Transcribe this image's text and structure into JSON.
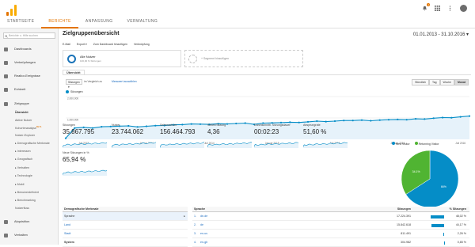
{
  "header": {
    "tabs": [
      "STARTSEITE",
      "BERICHTE",
      "ANPASSUNG",
      "VERWALTUNG"
    ],
    "active_tab": 1,
    "notification_count": "1",
    "colors": {
      "accent": "#e37400",
      "logo_a": "#f9ab00",
      "logo_b": "#e37400"
    }
  },
  "sidebar": {
    "search_placeholder": "Berichte u. Hilfe suchen",
    "items": [
      {
        "label": "Dashboards",
        "icon": "dashboard-icon"
      },
      {
        "label": "Verknüpfungen",
        "icon": "shortcut-icon"
      },
      {
        "label": "Realtor-Ereignisse",
        "icon": "bell-icon"
      },
      {
        "label": "Echtzeit",
        "icon": "clock-icon"
      },
      {
        "label": "Zielgruppe",
        "icon": "person-icon"
      },
      {
        "label": "Akquisition",
        "icon": "acquisition-icon"
      },
      {
        "label": "Verhalten",
        "icon": "behavior-icon"
      }
    ],
    "subitems": [
      "Übersicht",
      "Aktive Nutzer",
      "Kohortenanalyse",
      "Nutzer-Explorer",
      "▸ Demografische Merkmale",
      "▸ Interessen",
      "▸ Geografisch",
      "▸ Verhalten",
      "▸ Technologie",
      "▸ Mobil",
      "▸ Benutzerdefiniert",
      "▸ Benchmarking",
      "Nutzerfluss"
    ],
    "beta_badge": "BETA"
  },
  "main": {
    "title": "Zielgruppenübersicht",
    "date_range": "01.01.2013 - 31.10.2016",
    "toolbar": [
      "E-Mail",
      "Export ▾",
      "Zum Dashboard hinzufügen",
      "Verknüpfung"
    ],
    "segment": {
      "name": "Alle Nutzer",
      "sub": "100,00 % Sitzungen"
    },
    "add_segment": "+ Segment hinzufügen",
    "overview_tab": "Übersicht",
    "metric_select": "Sitzungen ▾",
    "vs_label": "im Vergleich zu",
    "pick_metric": "Messwert auswählen",
    "granularity": [
      "Stündlich",
      "Tag",
      "Woche",
      "Monat"
    ],
    "granularity_active": 3,
    "legend": "Sitzungen"
  },
  "chart_data": {
    "type": "line",
    "series": [
      {
        "name": "Sitzungen",
        "color": "#058dc7",
        "values": [
          50000,
          530000,
          560000,
          530000,
          590000,
          600000,
          620000,
          630000,
          580000,
          610000,
          640000,
          650000,
          680000,
          690000,
          720000,
          710000,
          700000,
          730000,
          720000,
          740000,
          760000,
          700000,
          760000,
          770000,
          780000,
          800000,
          790000,
          820000,
          850000,
          830000,
          850000,
          880000,
          880000,
          900000,
          870000,
          900000,
          920000,
          930000,
          920000,
          960000,
          950000,
          990000,
          1020000,
          1010000,
          1050000,
          1090000
        ]
      }
    ],
    "categories": [
      "Juli 2013",
      "Januar 2014",
      "Juli 2014",
      "Januar 2015",
      "Juli 2015",
      "Januar 2016",
      "Juli 2016"
    ],
    "yticks": [
      "2.000.000",
      "1.000.000"
    ],
    "ylim": [
      0,
      2000000
    ]
  },
  "metrics": [
    {
      "label": "Sitzungen",
      "value": "35.867.795"
    },
    {
      "label": "Nutzer",
      "value": "23.744.062"
    },
    {
      "label": "Seitenaufrufe",
      "value": "156.464.793"
    },
    {
      "label": "Seiten/Sitzung",
      "value": "4,36"
    },
    {
      "label": "Durchschnittl. Sitzungsdauer",
      "value": "00:02:23"
    },
    {
      "label": "Absprungrate",
      "value": "51,60 %"
    },
    {
      "label": "Neue Sitzungen in %",
      "value": "65,94 %"
    }
  ],
  "pie": {
    "legend": [
      {
        "label": "New Visitor",
        "color": "#058dc7"
      },
      {
        "label": "Returning Visitor",
        "color": "#50b432"
      }
    ],
    "slices": [
      {
        "label": "New Visitor",
        "value": 65.9
      },
      {
        "label": "Returning Visitor",
        "value": 34.1
      }
    ],
    "slice_labels": [
      "66%",
      "34.1%"
    ]
  },
  "table1": {
    "header": "Demografische Merkmale",
    "rows": [
      "Sprache",
      "Land",
      "Stadt"
    ],
    "section": "System"
  },
  "table2": {
    "header": [
      "Sprache",
      "Sitzungen",
      "% Sitzungen"
    ],
    "rows": [
      {
        "idx": "1.",
        "name": "de-de",
        "value": "17.224.391",
        "pct": "48,02 %",
        "frac": 0.4802
      },
      {
        "idx": "2.",
        "name": "de",
        "value": "15.842.618",
        "pct": "44,17 %",
        "frac": 0.4417
      },
      {
        "idx": "3.",
        "name": "en-us",
        "value": "811.491",
        "pct": "2,26 %",
        "frac": 0.0226
      },
      {
        "idx": "4.",
        "name": "en-gb",
        "value": "304.982",
        "pct": "0,85 %",
        "frac": 0.0085
      }
    ]
  }
}
